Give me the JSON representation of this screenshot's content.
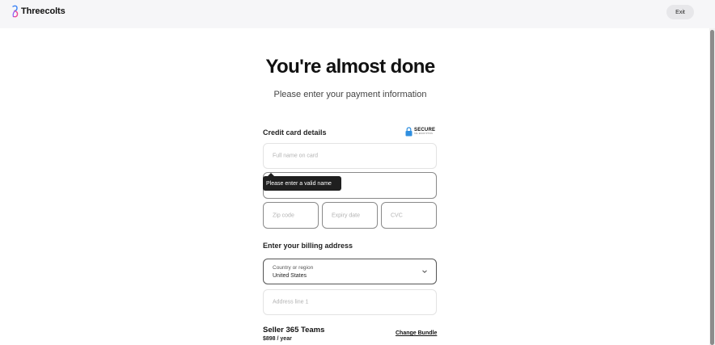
{
  "header": {
    "brand": "Threecolts",
    "exit_label": "Exit"
  },
  "page": {
    "headline": "You're almost done",
    "subhead": "Please enter your payment information"
  },
  "credit_card": {
    "section_title": "Credit card details",
    "secure_badge": {
      "label": "SECURE",
      "sublabel": "SSL ENCRYPTION"
    },
    "full_name_placeholder": "Full name on card",
    "validation_tooltip": "Please enter a valid name",
    "zip_placeholder": "Zip code",
    "expiry_placeholder": "Expiry date",
    "cvc_placeholder": "CVC"
  },
  "billing": {
    "section_title": "Enter your billing address",
    "country_label": "Country or region",
    "country_value": "United States",
    "address_line1_placeholder": "Address line 1"
  },
  "plan": {
    "name": "Seller 365 Teams",
    "price": "$898 / year",
    "change_link": "Change Bundle"
  },
  "icons": {
    "logo": "threecolts-logo-icon",
    "secure": "lock-icon",
    "dropdown": "chevron-down-icon"
  },
  "colors": {
    "secure_lock": "#2f8fe0",
    "logo_blue": "#3b82f6",
    "logo_pink": "#ec4899",
    "tooltip_bg": "#1f1f1f"
  }
}
